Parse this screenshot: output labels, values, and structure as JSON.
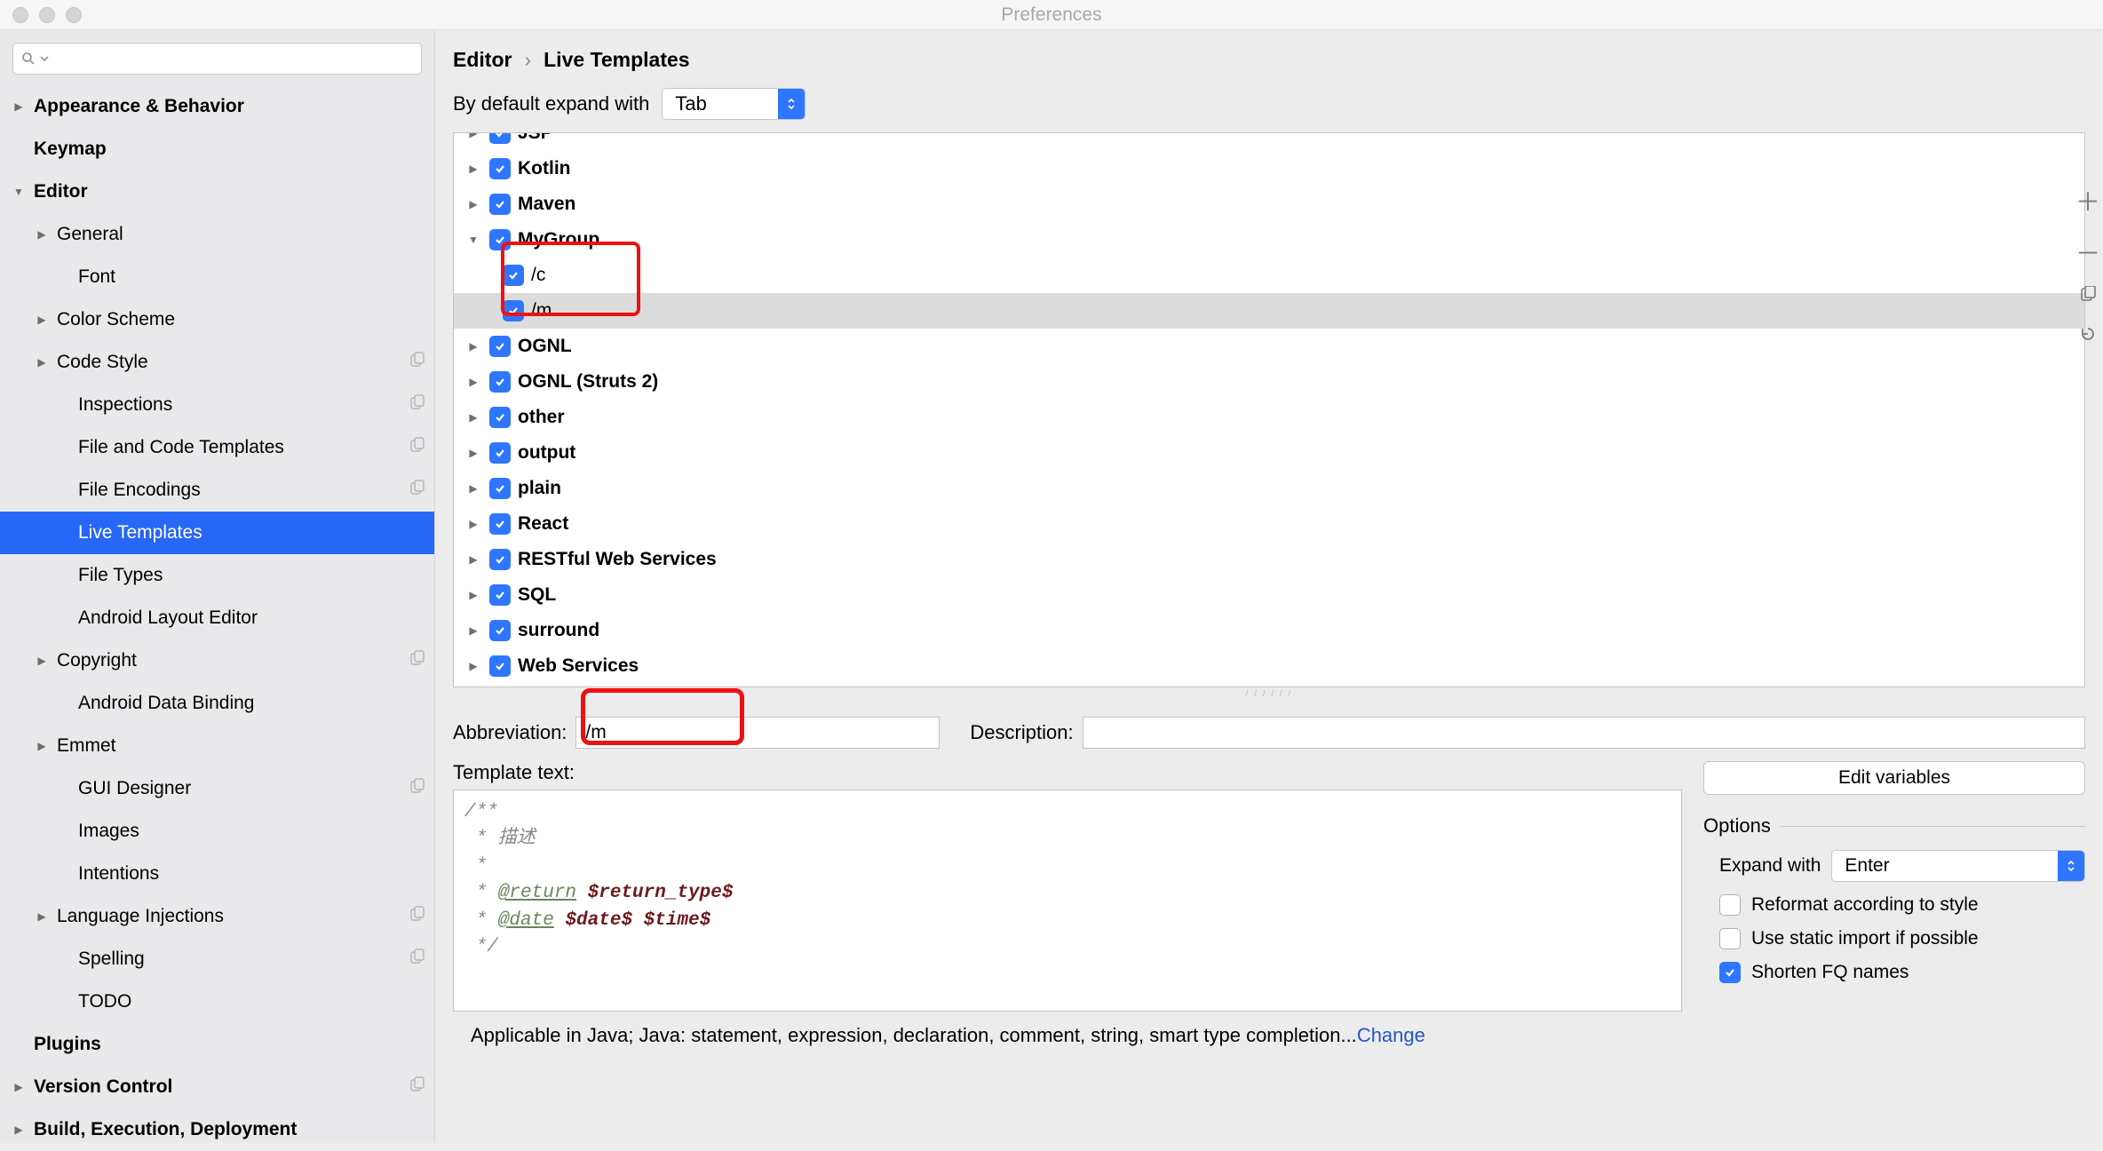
{
  "window_title": "Preferences",
  "breadcrumb": {
    "a": "Editor",
    "b": "Live Templates"
  },
  "expand_label": "By default expand with",
  "expand_value": "Tab",
  "sidebar": {
    "items": [
      {
        "label": "Appearance & Behavior",
        "arrow": "right",
        "bold": true,
        "indent": 0
      },
      {
        "label": "Keymap",
        "bold": true,
        "indent": 0
      },
      {
        "label": "Editor",
        "arrow": "down",
        "bold": true,
        "indent": 0
      },
      {
        "label": "General",
        "arrow": "right",
        "indent": 1
      },
      {
        "label": "Font",
        "indent": 2
      },
      {
        "label": "Color Scheme",
        "arrow": "right",
        "indent": 1
      },
      {
        "label": "Code Style",
        "arrow": "right",
        "indent": 1,
        "copy": true
      },
      {
        "label": "Inspections",
        "indent": 2,
        "copy": true
      },
      {
        "label": "File and Code Templates",
        "indent": 2,
        "copy": true
      },
      {
        "label": "File Encodings",
        "indent": 2,
        "copy": true
      },
      {
        "label": "Live Templates",
        "indent": 2,
        "selected": true
      },
      {
        "label": "File Types",
        "indent": 2
      },
      {
        "label": "Android Layout Editor",
        "indent": 2
      },
      {
        "label": "Copyright",
        "arrow": "right",
        "indent": 1,
        "copy": true
      },
      {
        "label": "Android Data Binding",
        "indent": 2
      },
      {
        "label": "Emmet",
        "arrow": "right",
        "indent": 1
      },
      {
        "label": "GUI Designer",
        "indent": 2,
        "copy": true
      },
      {
        "label": "Images",
        "indent": 2
      },
      {
        "label": "Intentions",
        "indent": 2
      },
      {
        "label": "Language Injections",
        "arrow": "right",
        "indent": 1,
        "copy": true
      },
      {
        "label": "Spelling",
        "indent": 2,
        "copy": true
      },
      {
        "label": "TODO",
        "indent": 2
      },
      {
        "label": "Plugins",
        "bold": true,
        "indent": 0
      },
      {
        "label": "Version Control",
        "arrow": "right",
        "bold": true,
        "indent": 0,
        "copy": true
      },
      {
        "label": "Build, Execution, Deployment",
        "arrow": "right",
        "bold": true,
        "indent": 0
      }
    ]
  },
  "tree": [
    {
      "label": "JSP",
      "arrow": "right",
      "level": 0,
      "cut": true
    },
    {
      "label": "Kotlin",
      "arrow": "right",
      "level": 0
    },
    {
      "label": "Maven",
      "arrow": "right",
      "level": 0
    },
    {
      "label": "MyGroup",
      "arrow": "down",
      "level": 0
    },
    {
      "label": "/c",
      "level": 1
    },
    {
      "label": "/m",
      "level": 1,
      "selected": true
    },
    {
      "label": "OGNL",
      "arrow": "right",
      "level": 0
    },
    {
      "label": "OGNL (Struts 2)",
      "arrow": "right",
      "level": 0
    },
    {
      "label": "other",
      "arrow": "right",
      "level": 0
    },
    {
      "label": "output",
      "arrow": "right",
      "level": 0
    },
    {
      "label": "plain",
      "arrow": "right",
      "level": 0
    },
    {
      "label": "React",
      "arrow": "right",
      "level": 0
    },
    {
      "label": "RESTful Web Services",
      "arrow": "right",
      "level": 0
    },
    {
      "label": "SQL",
      "arrow": "right",
      "level": 0
    },
    {
      "label": "surround",
      "arrow": "right",
      "level": 0
    },
    {
      "label": "Web Services",
      "arrow": "right",
      "level": 0
    }
  ],
  "form": {
    "abbr_label": "Abbreviation:",
    "abbr_value": "/m",
    "desc_label": "Description:",
    "desc_value": "",
    "tpl_label": "Template text:",
    "edit_vars": "Edit variables"
  },
  "template_text": {
    "l1": "/**",
    "l2": " * 描述",
    "l3": " *",
    "l4a": " * ",
    "l4b": "@return",
    "l4c": " ",
    "l4d": "$return_type$",
    "l5a": " * ",
    "l5b": "@date",
    "l5c": " ",
    "l5d": "$date$",
    "l5e": " ",
    "l5f": "$time$",
    "l6": " */"
  },
  "options": {
    "title": "Options",
    "expand_with_label": "Expand with",
    "expand_with_value": "Enter",
    "reformat": "Reformat according to style",
    "static_import": "Use static import if possible",
    "shorten": "Shorten FQ names"
  },
  "applicable": {
    "text": "Applicable in Java; Java: statement, expression, declaration, comment, string, smart type completion...",
    "link": "Change"
  }
}
